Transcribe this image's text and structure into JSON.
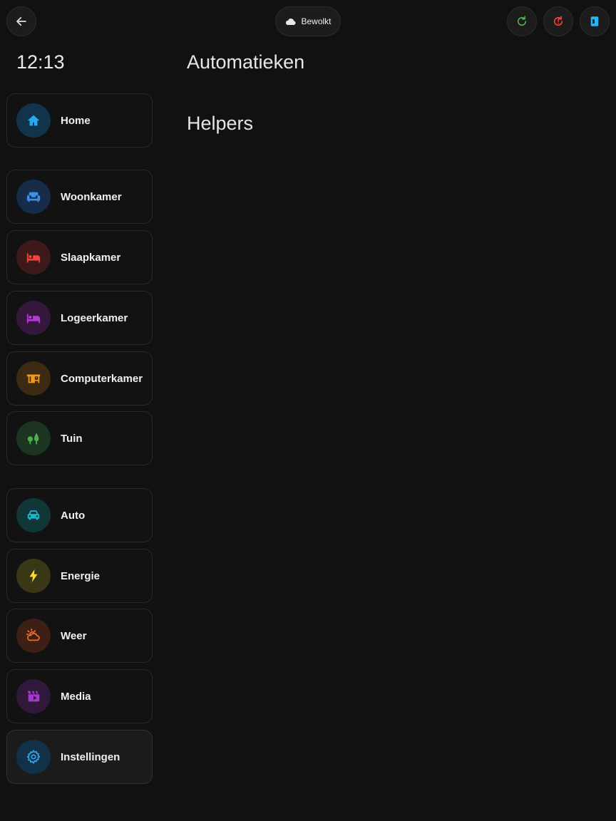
{
  "topbar": {
    "weather_label": "Bewolkt",
    "back_icon": "arrow-left-icon",
    "weather_icon": "cloud-icon",
    "actions": [
      {
        "icon": "refresh-icon",
        "color": "#4caf50"
      },
      {
        "icon": "alert-restart-icon",
        "color": "#f44336"
      },
      {
        "icon": "panel-icon",
        "color": "#29b6f6"
      }
    ]
  },
  "clock": "12:13",
  "main": {
    "sections": [
      "Automatieken",
      "Helpers"
    ]
  },
  "sidebar": {
    "items": [
      {
        "label": "Home",
        "icon": "home-icon",
        "color": "#29a8f0",
        "bg": "#11344b"
      },
      {
        "label": "Woonkamer",
        "icon": "sofa-icon",
        "color": "#3f8fe6",
        "bg": "#162c48"
      },
      {
        "label": "Slaapkamer",
        "icon": "bed-icon",
        "color": "#f0443a",
        "bg": "#3d1a19"
      },
      {
        "label": "Logeerkamer",
        "icon": "bed-guest-icon",
        "color": "#b23bd0",
        "bg": "#33183c"
      },
      {
        "label": "Computerkamer",
        "icon": "desk-icon",
        "color": "#f09a1c",
        "bg": "#3d2a12"
      },
      {
        "label": "Tuin",
        "icon": "tree-icon",
        "color": "#4caf50",
        "bg": "#1c3420"
      },
      {
        "label": "Auto",
        "icon": "car-icon",
        "color": "#19b7c9",
        "bg": "#113638"
      },
      {
        "label": "Energie",
        "icon": "lightning-icon",
        "color": "#f4dc34",
        "bg": "#3a3716"
      },
      {
        "label": "Weer",
        "icon": "weather-partly-icon",
        "color": "#f26a2c",
        "bg": "#3c1f15"
      },
      {
        "label": "Media",
        "icon": "clapperboard-icon",
        "color": "#a43bc8",
        "bg": "#30183b"
      },
      {
        "label": "Instellingen",
        "icon": "gear-icon",
        "color": "#2ea6ee",
        "bg": "#123047"
      }
    ]
  }
}
